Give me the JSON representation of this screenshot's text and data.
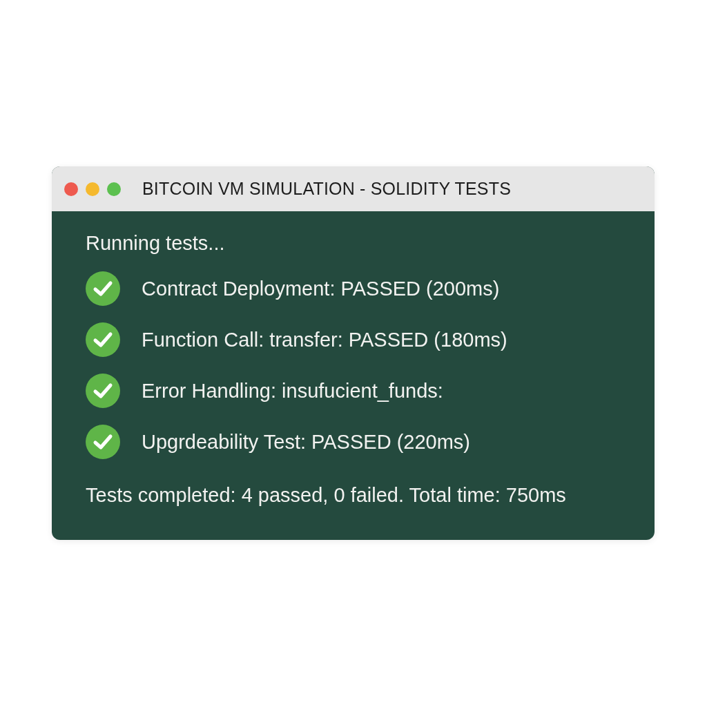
{
  "window": {
    "title": "BITCOIN VM SIMULATION - SOLIDITY TESTS",
    "controls": [
      {
        "color": "#ee5a4f"
      },
      {
        "color": "#f5b92e"
      },
      {
        "color": "#5cc04f"
      }
    ]
  },
  "console": {
    "header": "Running tests...",
    "tests": [
      {
        "text": "Contract Deployment: PASSED (200ms)",
        "passed": true
      },
      {
        "text": "Function Call: transfer: PASSED (180ms)",
        "passed": true
      },
      {
        "text": "Error Handling: insufucient_funds:",
        "passed": true
      },
      {
        "text": "Upgrdeability Test: PASSED (220ms)",
        "passed": true
      }
    ],
    "summary": "Tests completed: 4 passed, 0 failed. Total time: 750ms"
  }
}
